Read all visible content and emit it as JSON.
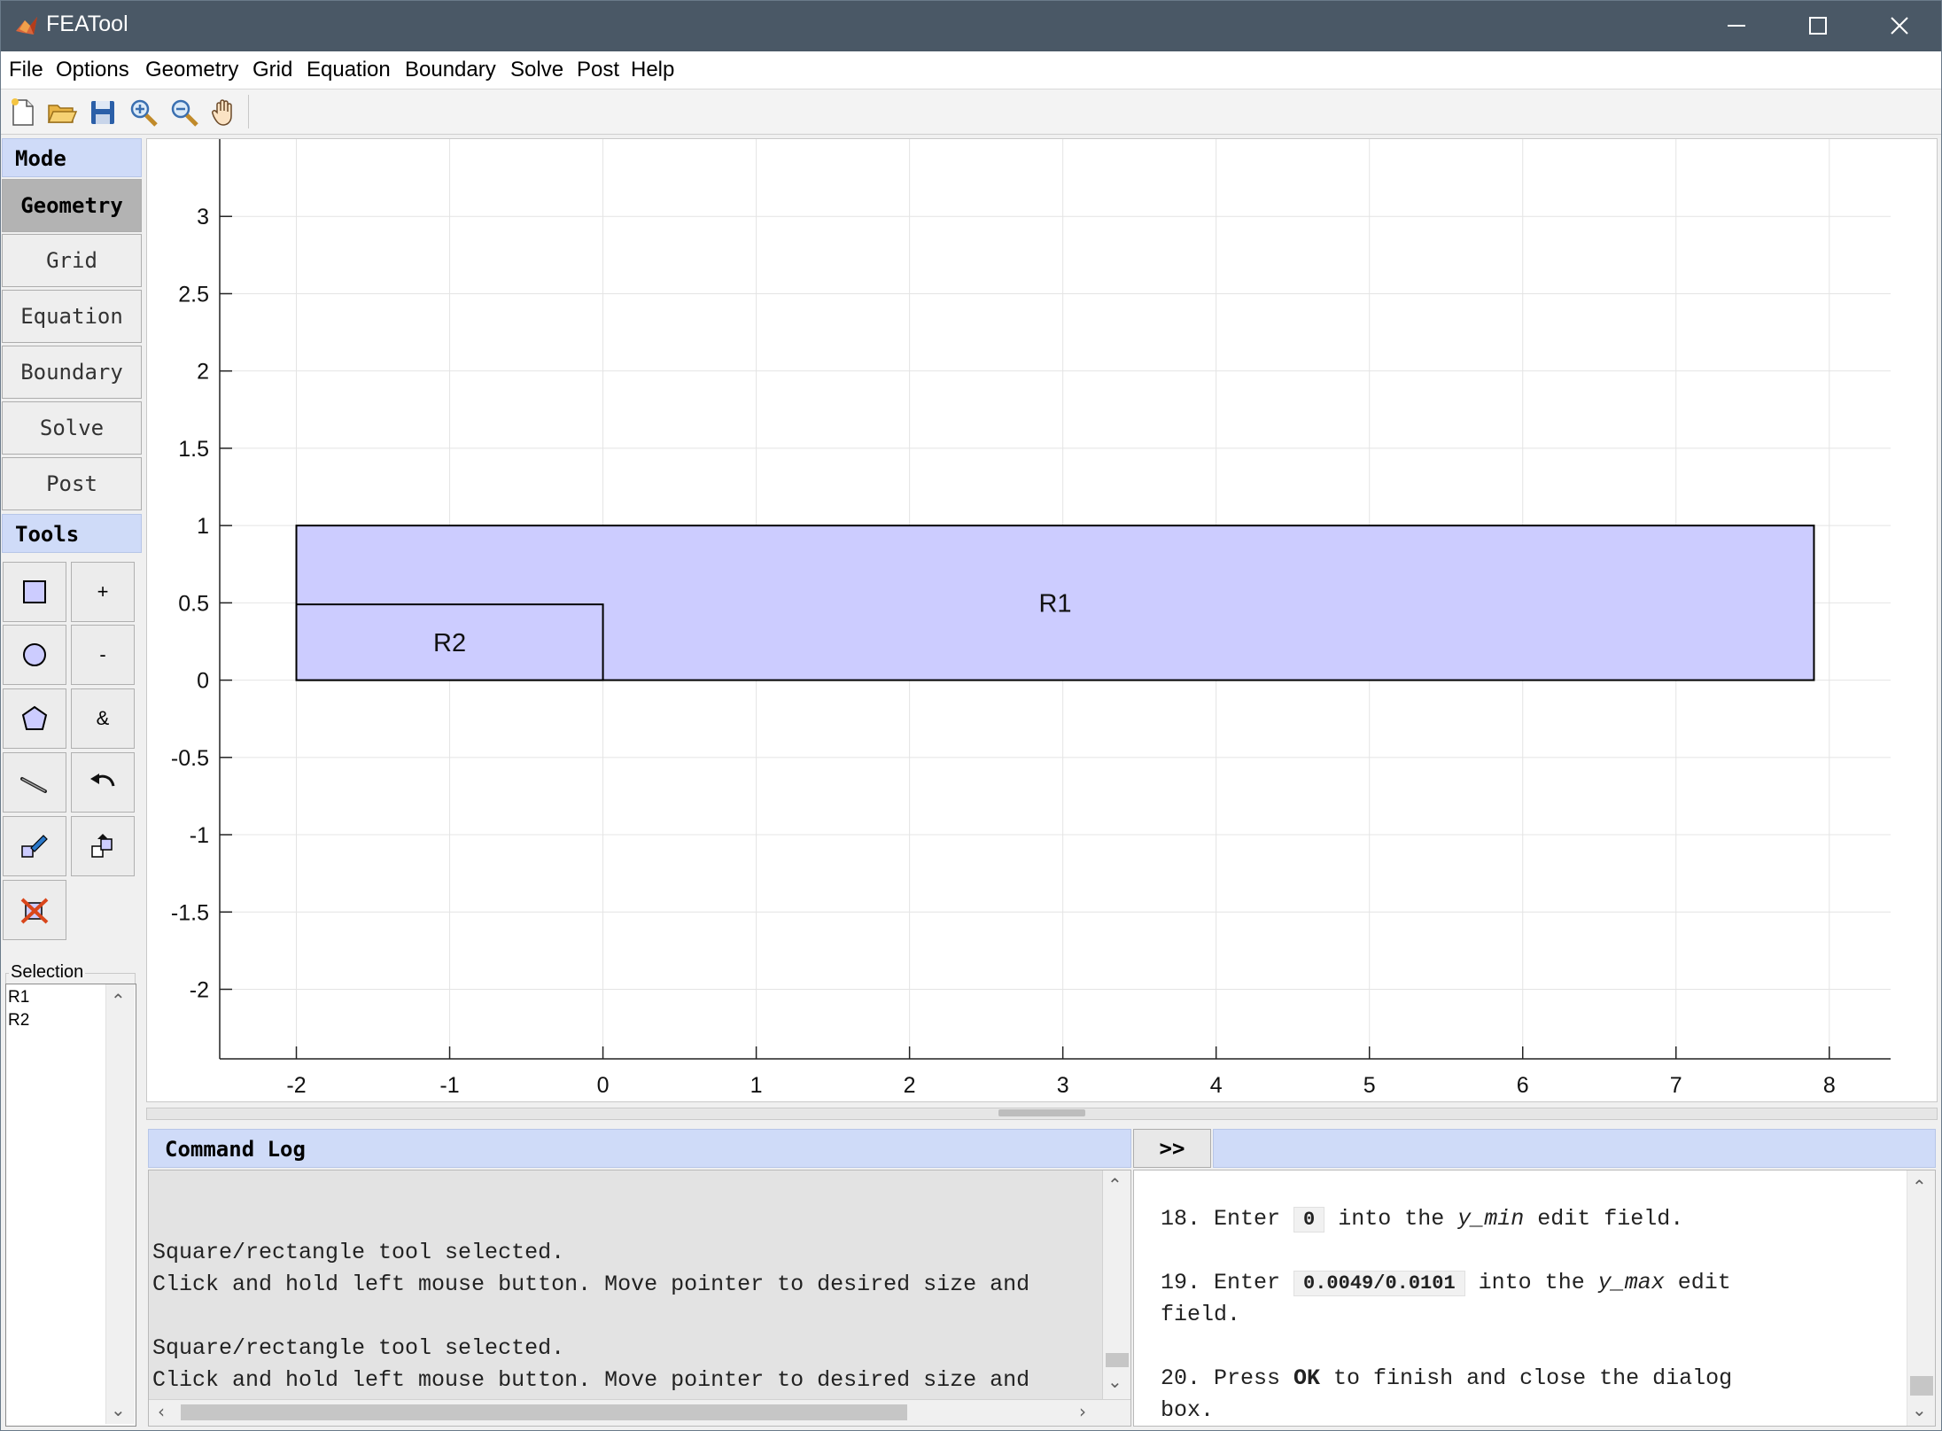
{
  "window": {
    "title": "FEATool",
    "minimize": "—",
    "maximize": "☐",
    "close": "✕"
  },
  "menu": [
    "File",
    "Options",
    "Geometry",
    "Grid",
    "Equation",
    "Boundary",
    "Solve",
    "Post",
    "Help"
  ],
  "toolbar": [
    "new-file-icon",
    "open-folder-icon",
    "save-icon",
    "zoom-in-icon",
    "zoom-out-icon",
    "pan-hand-icon"
  ],
  "left_panel": {
    "mode_header": "Mode",
    "modes": [
      "Geometry",
      "Grid",
      "Equation",
      "Boundary",
      "Solve",
      "Post"
    ],
    "active_mode": "Geometry",
    "tools_header": "Tools",
    "tools": [
      {
        "name": "rectangle-tool-icon",
        "label": ""
      },
      {
        "name": "union-button",
        "label": "+"
      },
      {
        "name": "circle-tool-icon",
        "label": ""
      },
      {
        "name": "subtract-button",
        "label": "-"
      },
      {
        "name": "polygon-tool-icon",
        "label": ""
      },
      {
        "name": "intersect-button",
        "label": "&"
      },
      {
        "name": "line-tool-icon",
        "label": ""
      },
      {
        "name": "undo-icon",
        "label": ""
      },
      {
        "name": "edit-object-icon",
        "label": ""
      },
      {
        "name": "transform-object-icon",
        "label": ""
      },
      {
        "name": "delete-object-icon",
        "label": ""
      }
    ],
    "selection_label": "Selection",
    "selection_items": [
      "R1",
      "R2"
    ]
  },
  "plot": {
    "x_ticks": [
      "-2",
      "-1",
      "0",
      "1",
      "2",
      "3",
      "4",
      "5",
      "6",
      "7",
      "8"
    ],
    "y_ticks": [
      "3",
      "2.5",
      "2",
      "1.5",
      "1",
      "0.5",
      "0",
      "-0.5",
      "-1",
      "-1.5",
      "-2"
    ],
    "xlim": [
      -2.5,
      8.4
    ],
    "ylim": [
      -2.45,
      3.5
    ],
    "fill_color": "#ccccff",
    "objects": [
      {
        "label": "R1",
        "xmin": -2,
        "xmax": 7.9,
        "ymin": 0,
        "ymax": 1
      },
      {
        "label": "R2",
        "xmin": -2,
        "xmax": 0,
        "ymin": 0,
        "ymax": 0.49
      }
    ]
  },
  "command_log": {
    "header": "Command Log",
    "expand_button": ">>",
    "lines": [
      "",
      "",
      "Square/rectangle tool selected.",
      "Click and hold left mouse button. Move pointer to desired size and",
      "",
      "Square/rectangle tool selected.",
      "Click and hold left mouse button. Move pointer to desired size and"
    ]
  },
  "help": {
    "step18": {
      "pre": "18. Enter ",
      "code": "0",
      "mid": " into the ",
      "field": "y_min",
      "post": " edit field."
    },
    "step19": {
      "pre": "19. Enter ",
      "code": "0.0049/0.0101",
      "mid": " into the ",
      "field": "y_max",
      "post": " edit",
      "cont": "field."
    },
    "step20": {
      "pre": "20. Press ",
      "bold": "OK",
      "post": " to finish and close the dialog",
      "cont": "box."
    }
  },
  "colors": {
    "title_bar": "#4a5866",
    "header_blue": "#cfdbf8",
    "active_mode": "#b3b3b3"
  }
}
